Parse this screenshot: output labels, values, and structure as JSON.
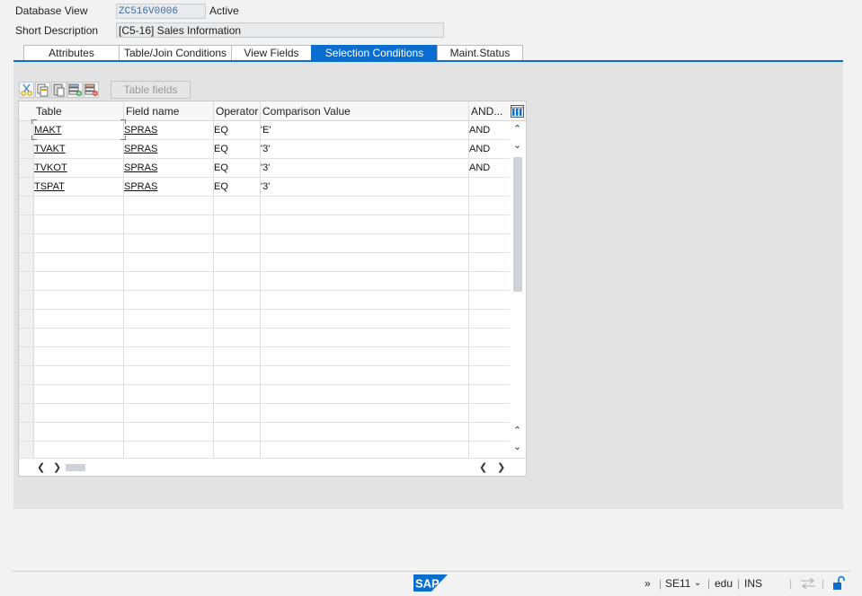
{
  "header": {
    "db_view_label": "Database View",
    "db_view_value": "ZC516V0006",
    "status": "Active",
    "short_desc_label": "Short Description",
    "short_desc_value": "[C5-16] Sales Information"
  },
  "tabs": [
    {
      "label": "Attributes",
      "active": false
    },
    {
      "label": "Table/Join Conditions",
      "active": false
    },
    {
      "label": "View Fields",
      "active": false
    },
    {
      "label": "Selection Conditions",
      "active": true
    },
    {
      "label": "Maint.Status",
      "active": false
    }
  ],
  "toolbar": {
    "buttons": [
      "cut-icon",
      "copy-icon",
      "paste-icon",
      "insert-row-icon",
      "delete-row-icon"
    ],
    "table_fields_label": "Table fields"
  },
  "grid": {
    "columns": [
      "Table",
      "Field name",
      "Operator",
      "Comparison Value",
      "AND..."
    ],
    "rows": [
      {
        "table": "MAKT",
        "field": "SPRAS",
        "op": "EQ",
        "value": "'E'",
        "and": "AND"
      },
      {
        "table": "TVAKT",
        "field": "SPRAS",
        "op": "EQ",
        "value": "'3'",
        "and": "AND"
      },
      {
        "table": "TVKOT",
        "field": "SPRAS",
        "op": "EQ",
        "value": "'3'",
        "and": "AND"
      },
      {
        "table": "TSPAT",
        "field": "SPRAS",
        "op": "EQ",
        "value": "'3'",
        "and": ""
      }
    ]
  },
  "statusbar": {
    "logo": "SAP",
    "chevrons": "»",
    "tcode": "SE11",
    "client": "edu",
    "mode": "INS"
  },
  "colors": {
    "accent": "#0a6ed1",
    "panel": "#e3e3e3",
    "field_bg": "#e9eaeb"
  }
}
